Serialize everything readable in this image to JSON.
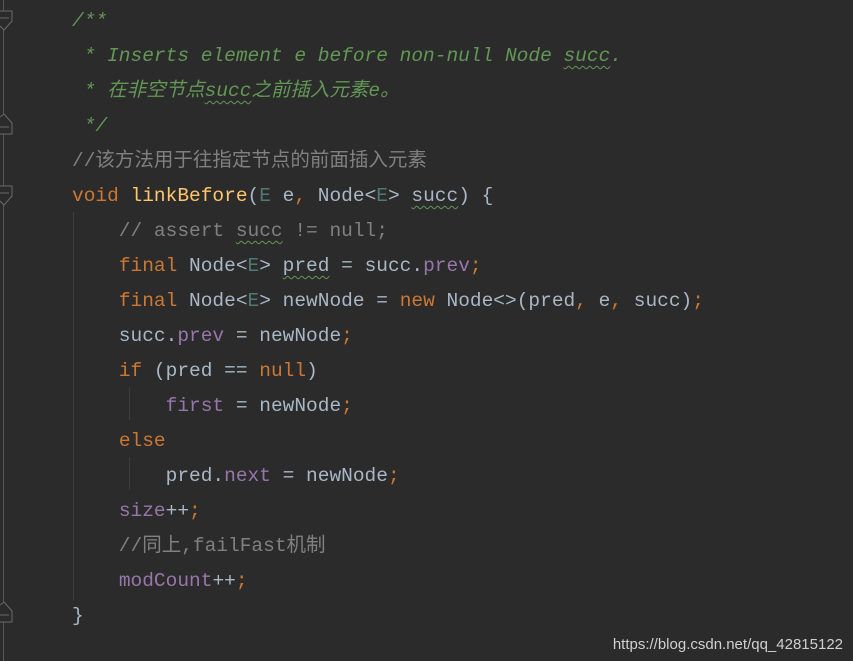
{
  "editor": {
    "theme": "darcula",
    "colors": {
      "background": "#2b2b2b",
      "keyword": "#cc7832",
      "method_decl": "#ffc66d",
      "doc_comment": "#629755",
      "line_comment": "#808080",
      "field": "#9876aa",
      "type_param": "#507874",
      "text": "#a9b7c6"
    },
    "lines": [
      {
        "tokens": [
          {
            "t": "/**",
            "c": "doc"
          }
        ]
      },
      {
        "tokens": [
          {
            "t": " * Inserts element e before non-null Node ",
            "c": "doc"
          },
          {
            "t": "succ",
            "c": "doc wavy"
          },
          {
            "t": ".",
            "c": "doc"
          }
        ]
      },
      {
        "tokens": [
          {
            "t": " * 在非空节点",
            "c": "doc"
          },
          {
            "t": "succ",
            "c": "doc wavy"
          },
          {
            "t": "之前插入元素e。",
            "c": "doc"
          }
        ]
      },
      {
        "tokens": [
          {
            "t": " */",
            "c": "doc"
          }
        ]
      },
      {
        "tokens": [
          {
            "t": "//该方法用于往指定节点的前面插入元素",
            "c": "cm"
          }
        ]
      },
      {
        "tokens": [
          {
            "t": "void",
            "c": "kw"
          },
          {
            "t": " ",
            "c": "plain"
          },
          {
            "t": "linkBefore",
            "c": "fn"
          },
          {
            "t": "(",
            "c": "plain"
          },
          {
            "t": "E",
            "c": "tp"
          },
          {
            "t": " e",
            "c": "plain"
          },
          {
            "t": ",",
            "c": "kw"
          },
          {
            "t": " Node<",
            "c": "plain"
          },
          {
            "t": "E",
            "c": "tp"
          },
          {
            "t": "> ",
            "c": "plain"
          },
          {
            "t": "succ",
            "c": "plain wavy"
          },
          {
            "t": ") {",
            "c": "plain"
          }
        ]
      },
      {
        "tokens": [
          {
            "t": "    // assert ",
            "c": "cm"
          },
          {
            "t": "succ",
            "c": "cm wavy"
          },
          {
            "t": " != null;",
            "c": "cm"
          }
        ]
      },
      {
        "tokens": [
          {
            "t": "    ",
            "c": "plain"
          },
          {
            "t": "final",
            "c": "kw"
          },
          {
            "t": " Node<",
            "c": "plain"
          },
          {
            "t": "E",
            "c": "tp"
          },
          {
            "t": "> ",
            "c": "plain"
          },
          {
            "t": "pred",
            "c": "plain wavy"
          },
          {
            "t": " = succ.",
            "c": "plain"
          },
          {
            "t": "prev",
            "c": "fld"
          },
          {
            "t": ";",
            "c": "kw"
          }
        ]
      },
      {
        "tokens": [
          {
            "t": "    ",
            "c": "plain"
          },
          {
            "t": "final",
            "c": "kw"
          },
          {
            "t": " Node<",
            "c": "plain"
          },
          {
            "t": "E",
            "c": "tp"
          },
          {
            "t": "> newNode = ",
            "c": "plain"
          },
          {
            "t": "new",
            "c": "kw"
          },
          {
            "t": " Node<>(pred",
            "c": "plain"
          },
          {
            "t": ",",
            "c": "kw"
          },
          {
            "t": " e",
            "c": "plain"
          },
          {
            "t": ",",
            "c": "kw"
          },
          {
            "t": " succ)",
            "c": "plain"
          },
          {
            "t": ";",
            "c": "kw"
          }
        ]
      },
      {
        "tokens": [
          {
            "t": "    succ.",
            "c": "plain"
          },
          {
            "t": "prev",
            "c": "fld"
          },
          {
            "t": " = newNode",
            "c": "plain"
          },
          {
            "t": ";",
            "c": "kw"
          }
        ]
      },
      {
        "tokens": [
          {
            "t": "    ",
            "c": "plain"
          },
          {
            "t": "if",
            "c": "kw"
          },
          {
            "t": " (pred == ",
            "c": "plain"
          },
          {
            "t": "null",
            "c": "kw"
          },
          {
            "t": ")",
            "c": "plain"
          }
        ]
      },
      {
        "tokens": [
          {
            "t": "        ",
            "c": "plain"
          },
          {
            "t": "first",
            "c": "fld"
          },
          {
            "t": " = newNode",
            "c": "plain"
          },
          {
            "t": ";",
            "c": "kw"
          }
        ]
      },
      {
        "tokens": [
          {
            "t": "    ",
            "c": "plain"
          },
          {
            "t": "else",
            "c": "kw"
          }
        ]
      },
      {
        "tokens": [
          {
            "t": "        pred.",
            "c": "plain"
          },
          {
            "t": "next",
            "c": "fld"
          },
          {
            "t": " = newNode",
            "c": "plain"
          },
          {
            "t": ";",
            "c": "kw"
          }
        ]
      },
      {
        "tokens": [
          {
            "t": "    ",
            "c": "plain"
          },
          {
            "t": "size",
            "c": "fld"
          },
          {
            "t": "++",
            "c": "plain"
          },
          {
            "t": ";",
            "c": "kw"
          }
        ]
      },
      {
        "tokens": [
          {
            "t": "    //同上,failFast机制",
            "c": "cm"
          }
        ]
      },
      {
        "tokens": [
          {
            "t": "    ",
            "c": "plain"
          },
          {
            "t": "modCount",
            "c": "fld"
          },
          {
            "t": "++",
            "c": "plain"
          },
          {
            "t": ";",
            "c": "kw"
          }
        ]
      },
      {
        "tokens": [
          {
            "t": "}",
            "c": "plain"
          }
        ]
      }
    ]
  },
  "gutter": {
    "fold_markers": [
      {
        "line": 1,
        "type": "fold-start"
      },
      {
        "line": 4,
        "type": "fold-end"
      },
      {
        "line": 6,
        "type": "fold-start"
      },
      {
        "line": 18,
        "type": "fold-end"
      }
    ]
  },
  "watermark": {
    "text": "https://blog.csdn.net/qq_42815122"
  }
}
